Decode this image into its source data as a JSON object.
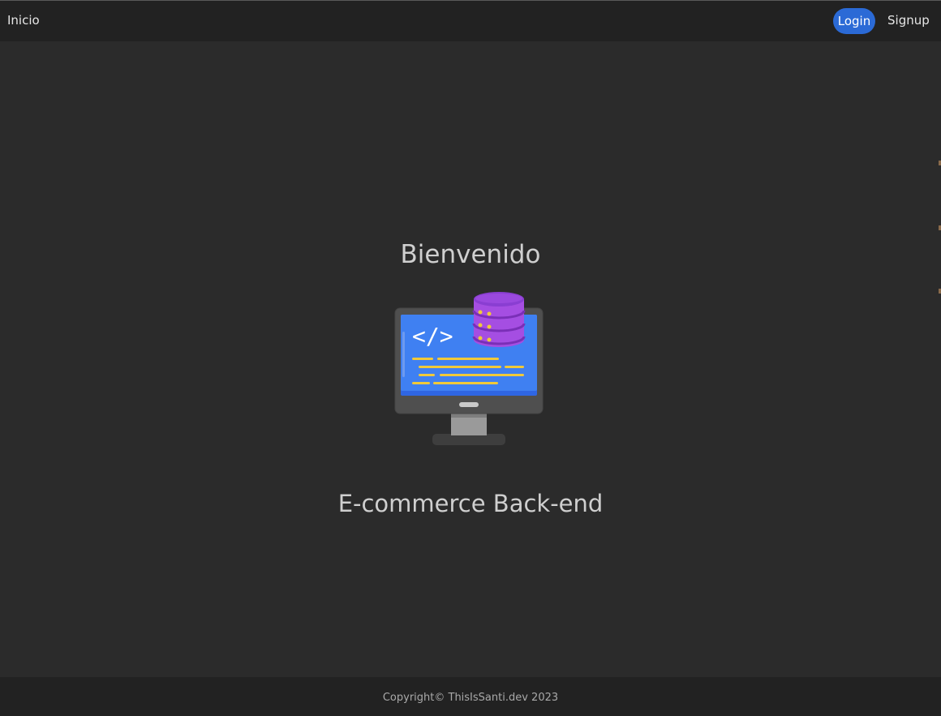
{
  "nav": {
    "home_label": "Inicio",
    "login_label": "Login",
    "signup_label": "Signup"
  },
  "hero": {
    "title": "Bienvenido",
    "subtitle": "E-commerce Back-end",
    "illustration_icon": "computer-database-code-icon"
  },
  "footer": {
    "copyright": "Copyright© ThisIsSanti.dev 2023"
  },
  "colors": {
    "background": "#2b2b2b",
    "navbar": "#222222",
    "accent": "#2b6ad6",
    "text": "#cfcfcf"
  }
}
